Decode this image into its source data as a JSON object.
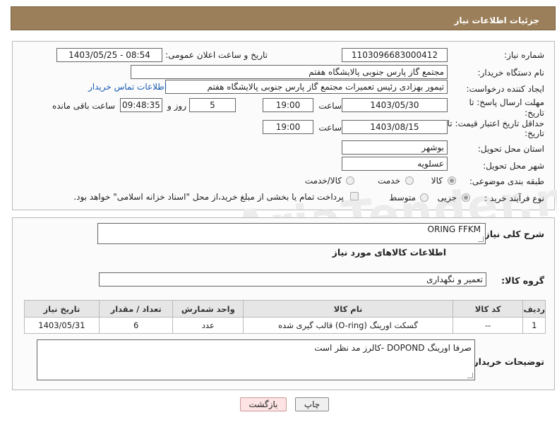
{
  "header": {
    "title": "جزئیات اطلاعات نیاز"
  },
  "form": {
    "need_number_label": "شماره نیاز:",
    "need_number": "1103096683000412",
    "announce_label": "تاریخ و ساعت اعلان عمومی:",
    "announce_value": "1403/05/25 - 08:54",
    "buyer_org_label": "نام دستگاه خریدار:",
    "buyer_org": "مجتمع گاز پارس جنوبی  پالایشگاه هفتم",
    "creator_label": "ایجاد کننده درخواست:",
    "creator": "تیمور بهزادی رئیس تعمیرات مجتمع گاز پارس جنوبی  پالایشگاه هفتم",
    "buyer_contact_link": "اطلاعات تماس خریدار",
    "deadline_label_1": "مهلت ارسال پاسخ: تا",
    "deadline_label_2": "تاریخ:",
    "deadline_date": "1403/05/30",
    "time_label": "ساعت",
    "deadline_time": "19:00",
    "days": "5",
    "days_label": "روز و",
    "remaining": "09:48:35",
    "remaining_label": "ساعت باقی مانده",
    "validity_label_1": "حداقل تاریخ اعتبار قیمت: تا",
    "validity_label_2": "تاریخ:",
    "validity_date": "1403/08/15",
    "validity_time": "19:00",
    "province_label": "استان محل تحویل:",
    "province": "بوشهر",
    "city_label": "شهر محل تحویل:",
    "city": "عسلویه",
    "category_label": "طبقه بندی موضوعی:",
    "category_options": [
      "کالا",
      "خدمت",
      "کالا/خدمت"
    ],
    "process_label": "نوع فرآیند خرید :",
    "process_options": [
      "جزیی",
      "متوسط"
    ],
    "payment_note": "پرداخت تمام یا بخشی از مبلغ خرید،از محل \"اسناد خزانه اسلامی\" خواهد بود."
  },
  "details": {
    "summary_label": "شرح کلی نیاز:",
    "summary": "ORING FFKM",
    "goods_info_title": "اطلاعات کالاهای مورد نیاز",
    "group_label": "گروه کالا:",
    "group": "تعمیر و نگهداری",
    "columns": [
      "ردیف",
      "کد کالا",
      "نام کالا",
      "واحد شمارش",
      "تعداد / مقدار",
      "تاریخ نیاز"
    ],
    "rows": [
      [
        "1",
        "--",
        "گسکت اورینگ (O-ring) قالب گیری شده",
        "عدد",
        "6",
        "1403/05/31"
      ]
    ],
    "buyer_notes_label": "توضیحات خریدار:",
    "buyer_notes": "صرفا اورینگ  DOPOND  -کالرز   مد نظر است"
  },
  "buttons": {
    "print": "چاپ",
    "back": "بازگشت"
  },
  "watermark": "AriaTender.neT"
}
